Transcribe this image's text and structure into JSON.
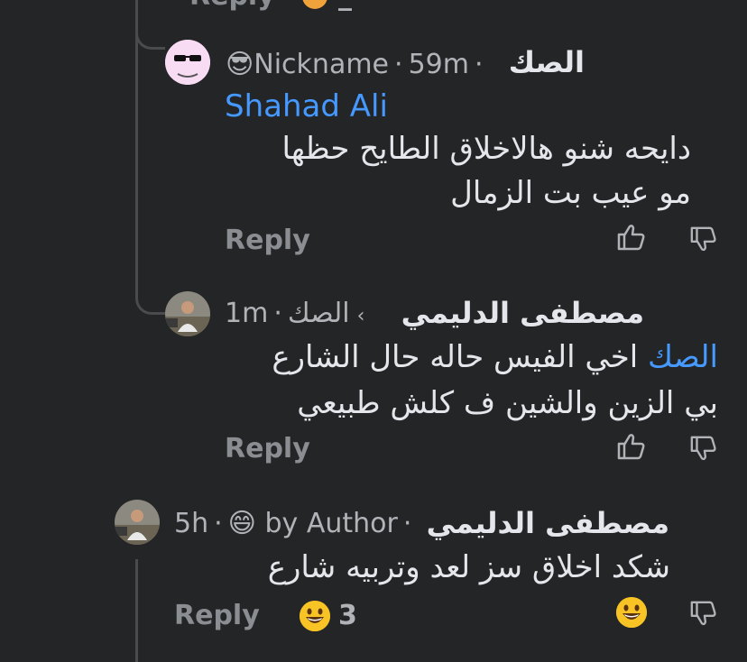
{
  "top_partial": {
    "reply_label": "Reply",
    "extra": "_"
  },
  "comments": [
    {
      "meta_badge": "Nickname",
      "time": "59m",
      "author": "الصك",
      "mention": "Shahad Ali",
      "line1": "دايحه شنو هالاخلاق الطايح حظها",
      "line2": "مو عيب بت الزمال",
      "reply_label": "Reply"
    },
    {
      "time": "1m",
      "replying_to": "الصك",
      "author": "مصطفى الدليمي",
      "mention": "الصك",
      "line1_rest": "اخي الفيس حاله حال الشارع",
      "line2": "بي الزين والشين ف كلش طبيعي",
      "reply_label": "Reply"
    },
    {
      "time": "5h",
      "badge": "by Author",
      "author": "مصطفى الدليمي",
      "line1": "شكد اخلاق سز لعد وتربيه شارع",
      "reply_label": "Reply",
      "reaction_count": "3"
    }
  ],
  "colors": {
    "background": "#242526",
    "text": "#e4e6eb",
    "muted": "#b0b3b8",
    "link": "#4599ff",
    "emoji": "#f7c325"
  },
  "icons": [
    "like-icon",
    "dislike-icon",
    "grinning-emoji-icon",
    "sunglasses-emoji-icon"
  ]
}
